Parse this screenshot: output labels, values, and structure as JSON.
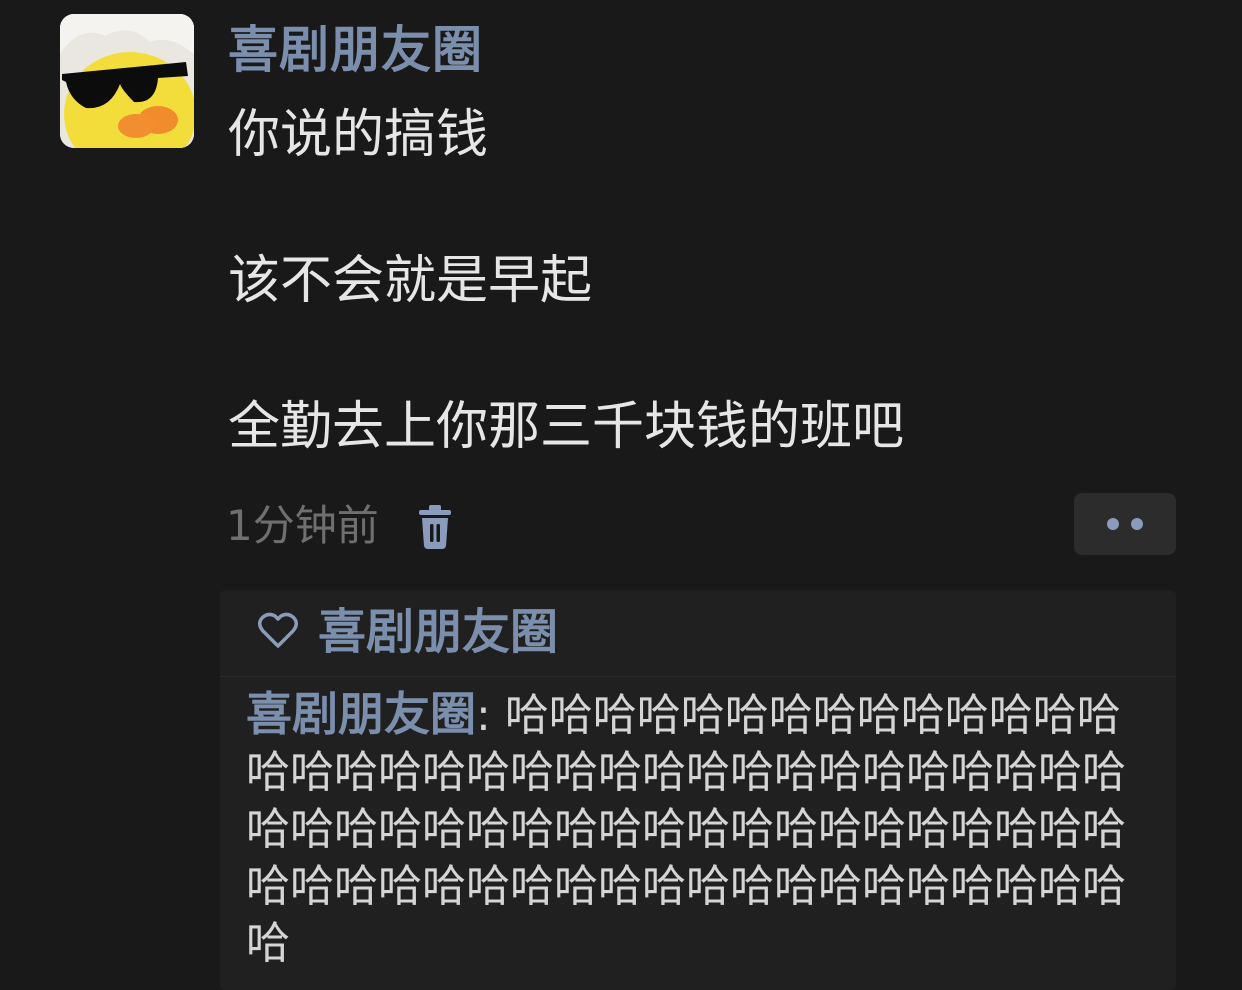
{
  "post": {
    "avatar_icon": "duck-with-sunglasses-avatar",
    "author": "喜剧朋友圈",
    "lines": [
      "你说的搞钱",
      "该不会就是早起",
      "全勤去上你那三千块钱的班吧"
    ],
    "time": "1分钟前",
    "delete_icon": "trash-icon",
    "more_icon": "more-dots-icon"
  },
  "interactions": {
    "like_icon": "heart-icon",
    "likers": "喜剧朋友圈",
    "comments": [
      {
        "author": "喜剧朋友圈",
        "separator": ": ",
        "text": "哈哈哈哈哈哈哈哈哈哈哈哈哈哈哈哈哈哈哈哈哈哈哈哈哈哈哈哈哈哈哈哈哈哈哈哈哈哈哈哈哈哈哈哈哈哈哈哈哈哈哈哈哈哈哈哈哈哈哈哈哈哈哈哈哈哈哈哈哈哈哈哈哈哈哈"
      }
    ]
  },
  "colors": {
    "background": "#191919",
    "name_accent": "#7b8eac",
    "body_text": "#e6e6e6",
    "meta_text": "#6f6f6f",
    "panel": "#202020"
  }
}
